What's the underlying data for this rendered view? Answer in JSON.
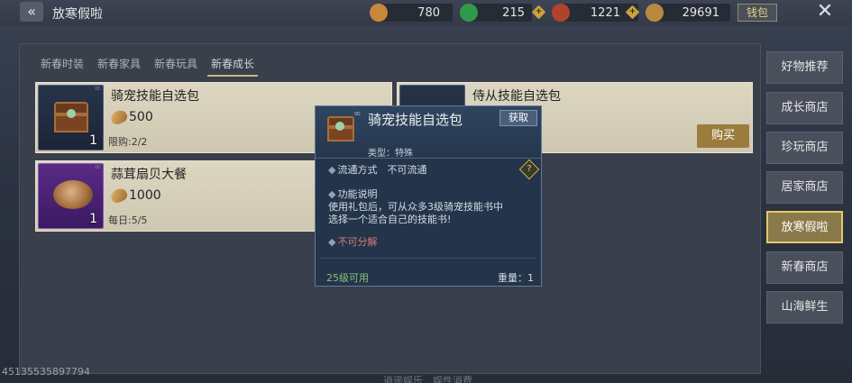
{
  "header": {
    "title": "放寒假啦",
    "wallet_label": "钱包",
    "currencies": [
      {
        "name": "gold-ingot",
        "value": "780",
        "color": "#c8873a"
      },
      {
        "name": "jade",
        "value": "215",
        "color": "#2f9a4a"
      },
      {
        "name": "red-coin",
        "value": "1221",
        "color": "#b0442a"
      },
      {
        "name": "shell-coin",
        "value": "29691",
        "color": "#b88a3e"
      }
    ]
  },
  "tabs": [
    {
      "label": "新春时装",
      "active": false
    },
    {
      "label": "新春家具",
      "active": false
    },
    {
      "label": "新春玩具",
      "active": false
    },
    {
      "label": "新春成长",
      "active": true
    }
  ],
  "items": [
    {
      "name": "骑宠技能自选包",
      "price": "500",
      "limit": "限购:2/2",
      "qty": "1",
      "rarity": "blue"
    },
    {
      "name": "侍从技能自选包",
      "buy_label": "购买"
    },
    {
      "name": "蒜茸扇贝大餐",
      "price": "1000",
      "limit": "每日:5/5",
      "qty": "1",
      "rarity": "purple"
    }
  ],
  "tooltip": {
    "name": "骑宠技能自选包",
    "acquire_label": "获取",
    "type": "类型：特殊",
    "trade": "流通方式　不可流通",
    "help_symbol": "?",
    "function_title": "功能说明",
    "function_desc_1": "使用礼包后，可从众多3级骑宠技能书中",
    "function_desc_2": "选择一个适合自己的技能书!",
    "no_decompose": "不可分解",
    "level_req": "25级可用",
    "weight": "重量：1"
  },
  "sidebar": [
    {
      "label": "好物推荐",
      "active": false
    },
    {
      "label": "成长商店",
      "active": false
    },
    {
      "label": "珍玩商店",
      "active": false
    },
    {
      "label": "居家商店",
      "active": false
    },
    {
      "label": "放寒假啦",
      "active": true
    },
    {
      "label": "新春商店",
      "active": false
    },
    {
      "label": "山海鲜生",
      "active": false
    }
  ],
  "uid": "45135535897794",
  "bottom_hint": "逍遥娱乐　娱性消费"
}
